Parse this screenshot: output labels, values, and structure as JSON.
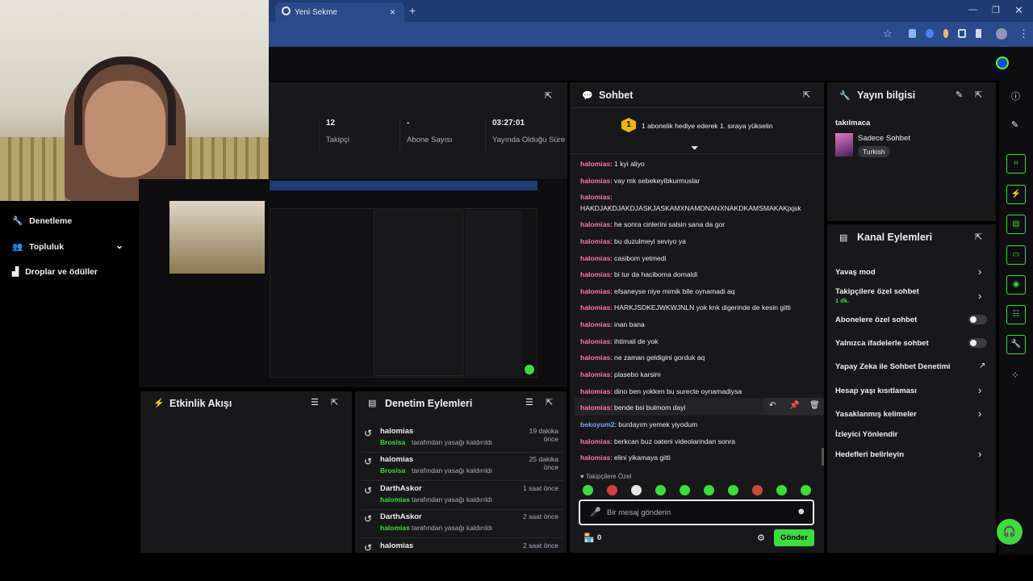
{
  "browser": {
    "tab_title": "Yeni Sekme",
    "new_tab": "+",
    "close_tab": "×"
  },
  "left_menu": [
    {
      "label": "Denetleme",
      "icon": "wrench-icon"
    },
    {
      "label": "Topluluk",
      "icon": "people-icon"
    },
    {
      "label": "Droplar ve ödüller",
      "icon": "drops-icon"
    }
  ],
  "stats": [
    {
      "value": "12",
      "label": "Takipçi"
    },
    {
      "value": "-",
      "label": "Abone Sayısı"
    },
    {
      "value": "03:27:01",
      "label": "Yayında Olduğu Süre"
    }
  ],
  "activity_feed": {
    "title": "Etkinlik Akışı"
  },
  "mod_actions": {
    "title": "Denetim Eylemleri",
    "items": [
      {
        "user": "halomias",
        "by": "Brosisa",
        "action": "tarafından yasağı kaldırıldı",
        "time": "19 dakika önce"
      },
      {
        "user": "halomias",
        "by": "Brosisa",
        "action": "tarafından yasağı kaldırıldı",
        "time": "25 dakika önce"
      },
      {
        "user": "DarthAskor",
        "by": "halomias",
        "action": "tarafından yasağı kaldırıldı",
        "time": "1 saat önce"
      },
      {
        "user": "DarthAskor",
        "by": "halomias",
        "action": "tarafından yasağı kaldırıldı",
        "time": "2 saat önce"
      },
      {
        "user": "halomias",
        "by": "",
        "action": "",
        "time": "2 saat önce"
      }
    ]
  },
  "chat": {
    "title": "Sohbet",
    "banner": "1 abonelik hediye ederek 1. sıraya yükselin",
    "banner_rank": "1",
    "messages": [
      {
        "user": "halomias",
        "text": "1 kyi aliyo"
      },
      {
        "user": "halomias",
        "text": "vay mk sebekeyibkurmuslar"
      },
      {
        "user": "halomias",
        "text": ""
      },
      {
        "user": "",
        "text": "HAKDJAKDJAKDJASKJASKAMXNAMDNANXNAKDKAMSMAKAKjxjsk"
      },
      {
        "user": "halomias",
        "text": "he sonra cinlerini salsin sana da gor"
      },
      {
        "user": "halomias",
        "text": "bu duzulmeyi seviyo ya"
      },
      {
        "user": "halomias",
        "text": "casibom yetmedi"
      },
      {
        "user": "halomias",
        "text": "bi tur da haciboma domaldi"
      },
      {
        "user": "halomias",
        "text": "efsaneyse niye mimik bile oynamadi aq"
      },
      {
        "user": "halomias",
        "text": "HARKJSDKEJWKWJNLN yok knk digerinde de kesin gitti"
      },
      {
        "user": "halomias",
        "text": "inan bana"
      },
      {
        "user": "halomias",
        "text": "ihtimali de yok"
      },
      {
        "user": "halomias",
        "text": "ne zaman geldigini gorduk aq"
      },
      {
        "user": "halomias",
        "text": "plasebo karsim"
      },
      {
        "user": "halomias",
        "text": "dino ben yokken bu surecte oynamadiysa"
      },
      {
        "user": "halomias",
        "text": "bende bsi bulmom dayi"
      },
      {
        "user": "bekoyum2",
        "text": "burdayım yemek yiyodum"
      },
      {
        "user": "halomias",
        "text": "berkcan buz oateni videolarindan sonra"
      },
      {
        "user": "halomias",
        "text": "elini yikamaya gitti"
      }
    ],
    "followers_only": "Takipçilere Özel",
    "input_placeholder": "Bir mesaj gönderin",
    "points": "0",
    "send": "Gönder"
  },
  "stream_info": {
    "title": "Yayın bilgisi",
    "stream_title": "takılmaca",
    "category": "Sadece Sohbet",
    "tag": "Turkish"
  },
  "channel_actions": {
    "title": "Kanal Eylemleri",
    "rows": [
      {
        "label": "Yavaş mod",
        "kind": "chevron"
      },
      {
        "label": "Takipçilere özel sohbet",
        "sub": "1 dk.",
        "kind": "chevron"
      },
      {
        "label": "Abonelere özel sohbet",
        "kind": "toggle"
      },
      {
        "label": "Yalnızca ifadelerle sohbet",
        "kind": "toggle"
      },
      {
        "label": "Yapay Zeka ile Sohbet Denetimi",
        "kind": "external"
      },
      {
        "label": "Hesap yaşı kısıtlaması",
        "kind": "chevron"
      },
      {
        "label": "Yasaklanmış kelimeler",
        "kind": "chevron"
      },
      {
        "label": "İzleyici Yönlendir",
        "kind": "none"
      },
      {
        "label": "Hedefleri belirleyin",
        "kind": "chevron"
      }
    ]
  },
  "colors": {
    "accent": "#3ddc3d",
    "username": "#ff75a8",
    "browser": "#1f3b73"
  }
}
